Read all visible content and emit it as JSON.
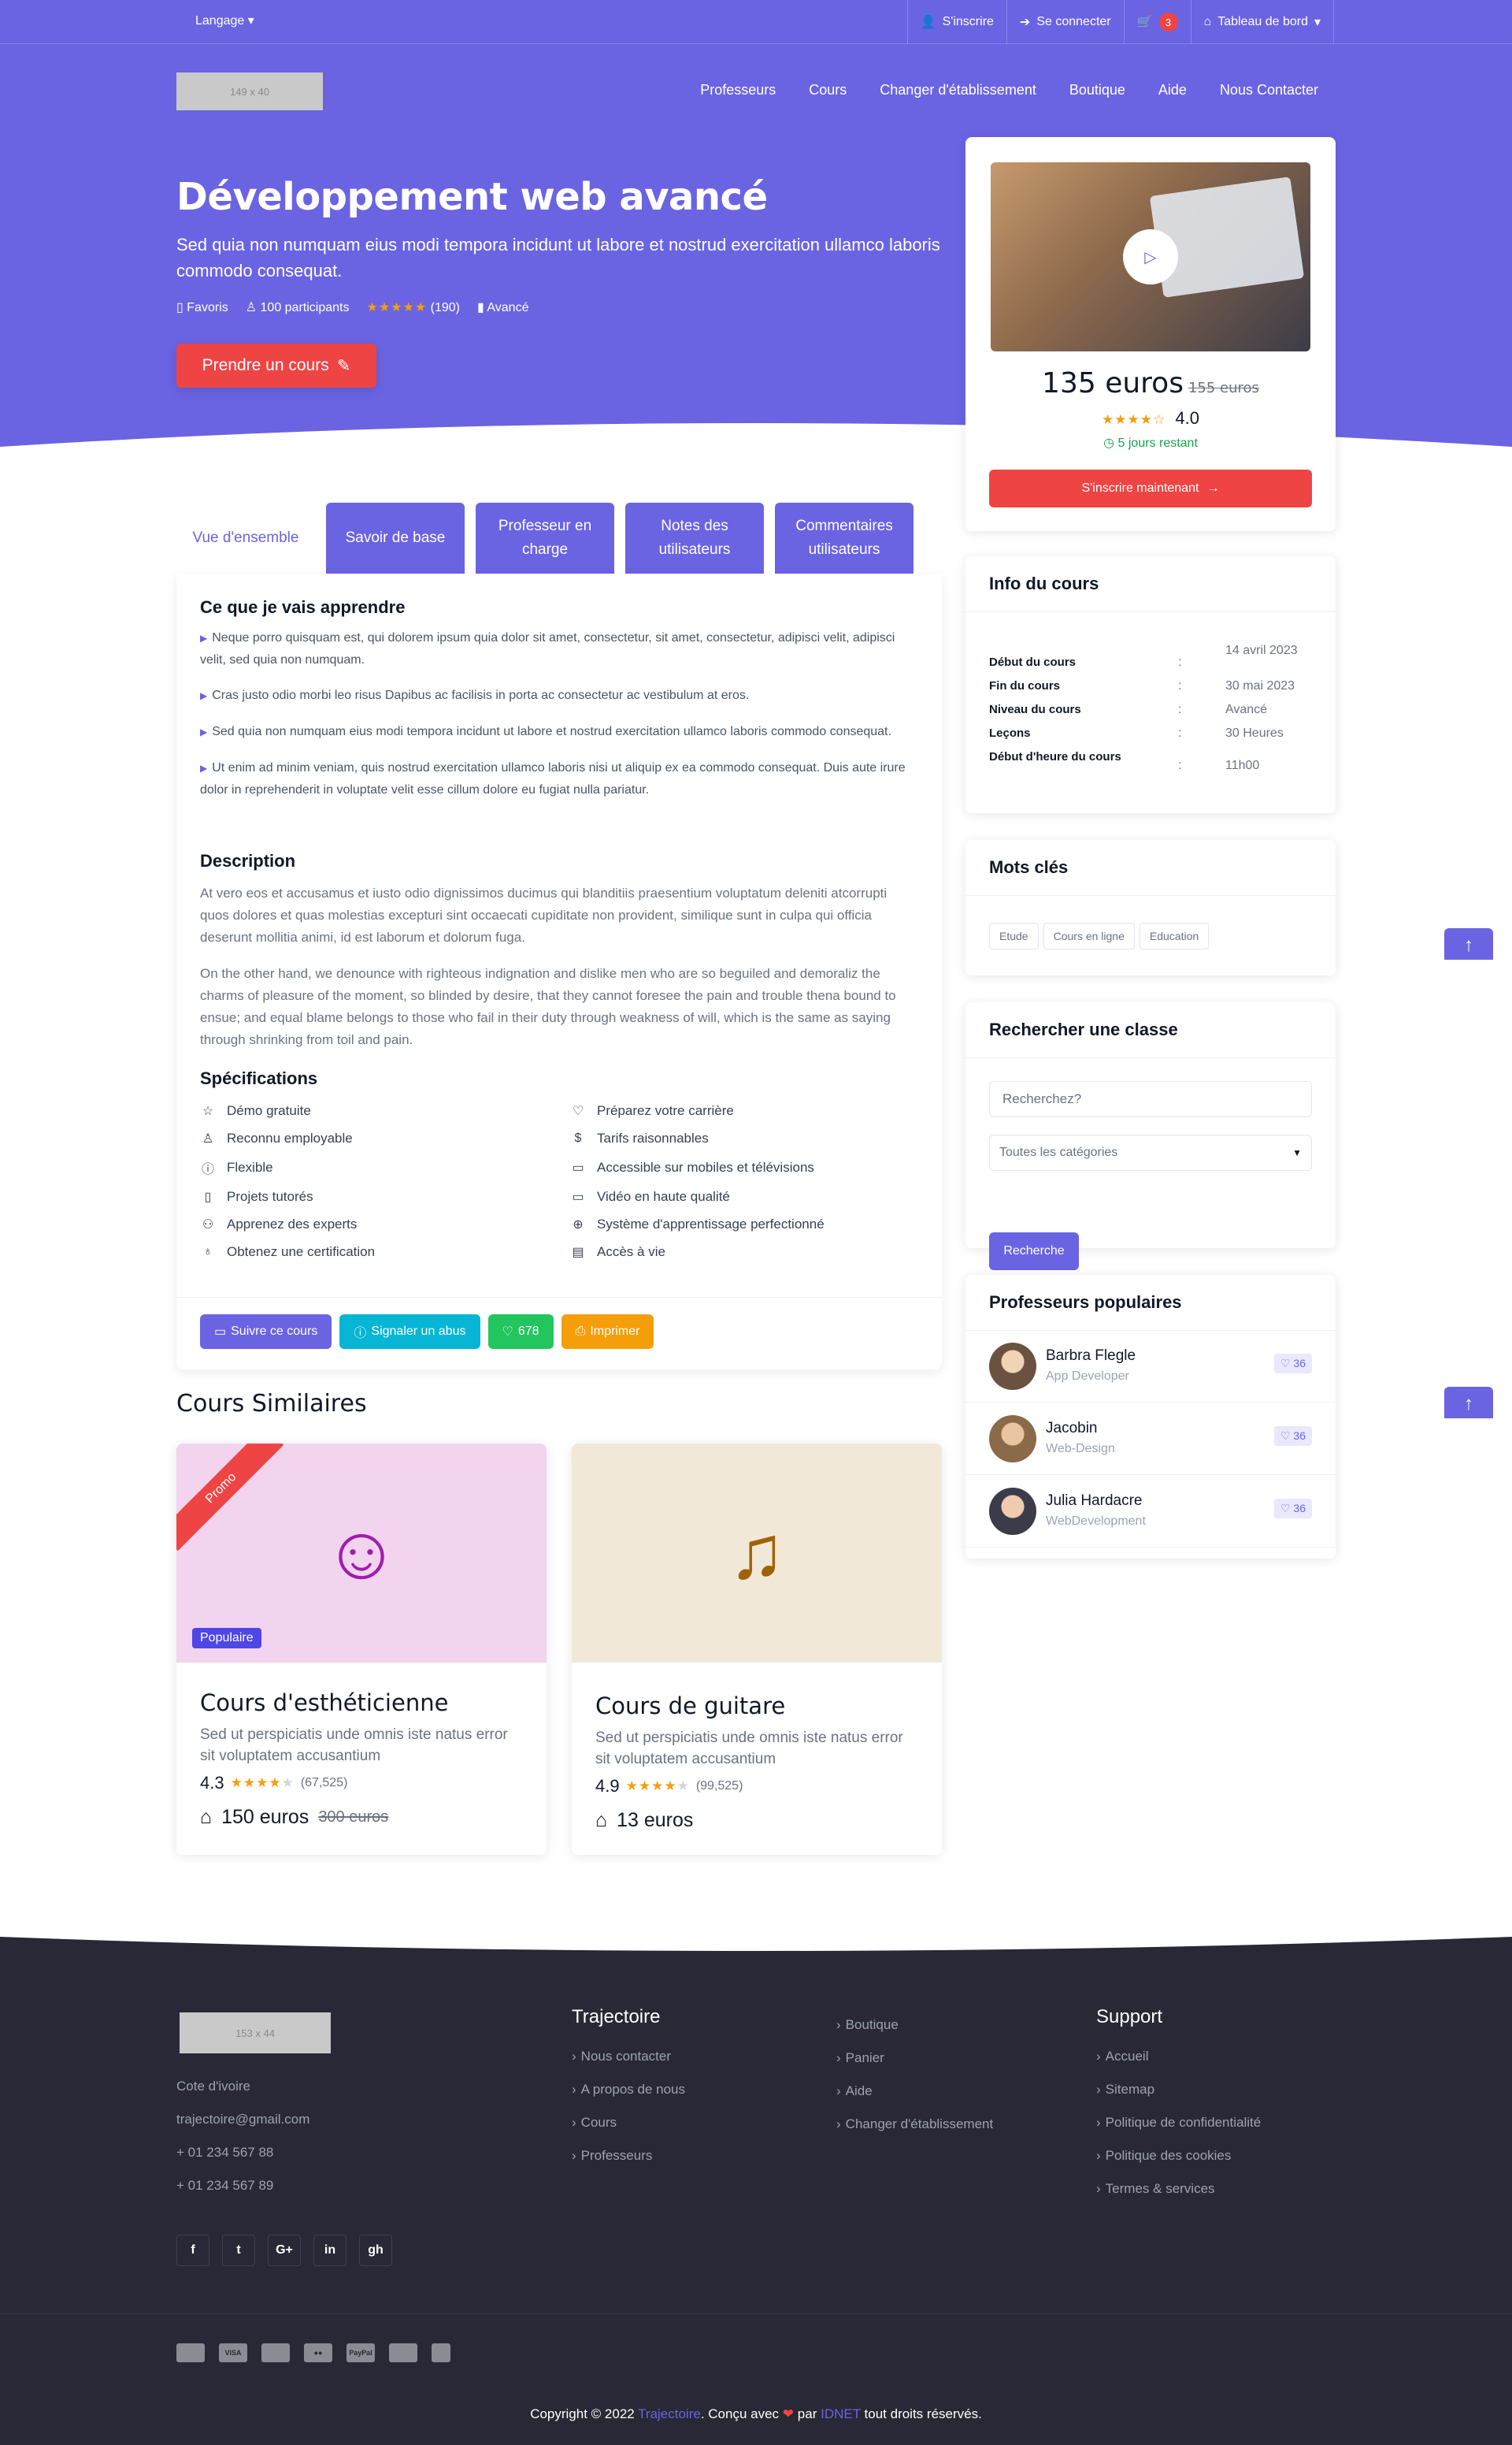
{
  "topbar": {
    "language": "Langage",
    "signup": "S'inscrire",
    "login": "Se connecter",
    "cart_count": "3",
    "dashboard": "Tableau de bord"
  },
  "logo_top": "149 x 40",
  "nav": [
    "Professeurs",
    "Cours",
    "Changer d'établissement",
    "Boutique",
    "Aide",
    "Nous Contacter"
  ],
  "hero": {
    "title": "Développement web avancé",
    "subtitle": "Sed quia non numquam eius modi tempora incidunt ut labore et nostrud exercitation ullamco laboris commodo consequat.",
    "favorites": "Favoris",
    "participants": "100 participants",
    "reviews": "(190)",
    "level": "Avancé",
    "cta": "Prendre un cours"
  },
  "price_card": {
    "price": "135 euros",
    "old_price": "155 euros",
    "rating": "4.0",
    "days_left": "5 jours restant",
    "enroll": "S'inscrire maintenant"
  },
  "tabs": [
    "Vue d'ensemble",
    "Savoir de base",
    "Professeur en charge",
    "Notes des utilisateurs",
    "Commentaires utilisateurs"
  ],
  "learn": {
    "heading": "Ce que je vais apprendre",
    "items": [
      "Neque porro quisquam est, qui dolorem ipsum quia dolor sit amet, consectetur, sit amet, consectetur, adipisci velit, adipisci velit, sed quia non numquam.",
      "Cras justo odio morbi leo risus Dapibus ac facilisis in porta ac consectetur ac vestibulum at eros.",
      "Sed quia non numquam eius modi tempora incidunt ut labore et nostrud exercitation ullamco laboris commodo consequat.",
      "Ut enim ad minim veniam, quis nostrud exercitation ullamco laboris nisi ut aliquip ex ea commodo consequat. Duis aute irure dolor in reprehenderit in voluptate velit esse cillum dolore eu fugiat nulla pariatur."
    ]
  },
  "description": {
    "heading": "Description",
    "p1": "At vero eos et accusamus et iusto odio dignissimos ducimus qui blanditiis praesentium voluptatum deleniti atcorrupti quos dolores et quas molestias excepturi sint occaecati cupiditate non provident, similique sunt in culpa qui officia deserunt mollitia animi, id est laborum et dolorum fuga.",
    "p2": "On the other hand, we denounce with righteous indignation and dislike men who are so beguiled and demoraliz the charms of pleasure of the moment, so blinded by desire, that they cannot foresee the pain and trouble thena bound to ensue; and equal blame belongs to those who fail in their duty through weakness of will, which is the same as saying through shrinking from toil and pain."
  },
  "specs": {
    "heading": "Spécifications",
    "items": [
      {
        "icon": "star-icon",
        "glyph": "☆",
        "label": "Démo gratuite"
      },
      {
        "icon": "heart-icon",
        "glyph": "♡",
        "label": "Préparez votre carrière"
      },
      {
        "icon": "user-icon",
        "glyph": "♙",
        "label": "Reconnu employable"
      },
      {
        "icon": "dollar-icon",
        "glyph": "$",
        "label": "Tarifs raisonnables"
      },
      {
        "icon": "info-icon",
        "glyph": "ⓘ",
        "label": "Flexible"
      },
      {
        "icon": "tv-icon",
        "glyph": "▭",
        "label": "Accessible sur mobiles et télévisions"
      },
      {
        "icon": "file-icon",
        "glyph": "▯",
        "label": "Projets tutorés"
      },
      {
        "icon": "monitor-icon",
        "glyph": "▭",
        "label": "Vidéo en haute qualité"
      },
      {
        "icon": "users-icon",
        "glyph": "⚇",
        "label": "Apprenez des experts"
      },
      {
        "icon": "globe-icon",
        "glyph": "⊕",
        "label": "Système d'apprentissage perfectionné"
      },
      {
        "icon": "award-icon",
        "glyph": "♁",
        "label": "Obtenez une certification"
      },
      {
        "icon": "card-icon",
        "glyph": "▤",
        "label": "Accès à vie"
      }
    ]
  },
  "actions": {
    "follow": "Suivre ce cours",
    "report": "Signaler un abus",
    "likes": "678",
    "print": "Imprimer"
  },
  "similar": {
    "heading": "Cours Similaires",
    "courses": [
      {
        "name": "Cours d'esthéticienne",
        "desc": "Sed ut perspiciatis unde omnis iste natus error sit voluptatem accusantium",
        "rating": "4.3",
        "reviews": "(67,525)",
        "price": "150 euros",
        "old_price": "300 euros",
        "ribbon": "Promo",
        "badge": "Populaire"
      },
      {
        "name": "Cours de guitare",
        "desc": "Sed ut perspiciatis unde omnis iste natus error sit voluptatem accusantium",
        "rating": "4.9",
        "reviews": "(99,525)",
        "price": "13 euros"
      }
    ]
  },
  "info": {
    "heading": "Info du cours",
    "rows": [
      {
        "k": "Début du cours",
        "v": "14 avril 2023"
      },
      {
        "k": "Fin du cours",
        "v": "30 mai 2023"
      },
      {
        "k": "Niveau du cours",
        "v": "Avancé"
      },
      {
        "k": "Leçons",
        "v": "30 Heures"
      },
      {
        "k": "Début d'heure du cours",
        "v": "11h00"
      }
    ]
  },
  "keywords": {
    "heading": "Mots clés",
    "tags": [
      "Etude",
      "Cours en ligne",
      "Education"
    ]
  },
  "search": {
    "heading": "Rechercher une classe",
    "placeholder": "Recherchez?",
    "category": "Toutes les catégories",
    "button": "Recherche"
  },
  "profs": {
    "heading": "Professeurs populaires",
    "items": [
      {
        "name": "Barbra Flegle",
        "role": "App Developer",
        "likes": "36"
      },
      {
        "name": "Jacobin",
        "role": "Web-Design",
        "likes": "36"
      },
      {
        "name": "Julia Hardacre",
        "role": "WebDevelopment",
        "likes": "36"
      }
    ]
  },
  "footer": {
    "logo": "153 x 44",
    "contact": [
      "Cote d'ivoire",
      "trajectoire@gmail.com",
      "+ 01 234 567 88",
      "+ 01 234 567 89"
    ],
    "col1_heading": "Trajectoire",
    "col1": [
      "Nous contacter",
      "A propos de nous",
      "Cours",
      "Professeurs"
    ],
    "col2": [
      "Boutique",
      "Panier",
      "Aide",
      "Changer d'établissement"
    ],
    "col3_heading": "Support",
    "col3": [
      "Accueil",
      "Sitemap",
      "Politique de confidentialité",
      "Politique des cookies",
      "Termes & services"
    ],
    "social": [
      "f",
      "t",
      "G+",
      "in",
      "gh"
    ],
    "payments": [
      "card",
      "VISA",
      "card",
      "mc",
      "PayPal",
      "card",
      "w"
    ],
    "copy_pre": "Copyright © 2022",
    "brand": "Trajectoire",
    "copy_mid": ". Conçu avec",
    "copy_by": "par",
    "author": "IDNET",
    "copy_post": "tout droits réservés."
  },
  "colors": {
    "primary": "#6a64e3",
    "danger": "#ef4444",
    "info": "#06b6d4",
    "success": "#22c55e",
    "warning": "#f59e0b",
    "footer": "#282836"
  }
}
